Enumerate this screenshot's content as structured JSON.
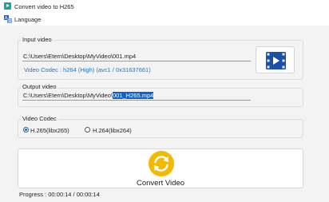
{
  "window": {
    "title": "Convert video to H265"
  },
  "menu": {
    "language_label": "Language"
  },
  "input_video": {
    "label": "Input video",
    "path": "C:\\Users\\Etern\\Desktop\\MyVideo\\001.mp4",
    "codec_info": "Video Codec : h264 (High) (avc1 / 0x31637661)"
  },
  "output_video": {
    "label": "Output video",
    "path_prefix": "C:\\Users\\Etern\\Desktop\\MyVideo\\",
    "path_selected": "001_H265.mp4"
  },
  "video_codec": {
    "label": "Video Codec",
    "options": [
      {
        "label": "H.265(libx265)",
        "selected": true
      },
      {
        "label": "H.264(libx264)",
        "selected": false
      }
    ]
  },
  "convert": {
    "label": "Convert Video"
  },
  "status": {
    "progress_text": "Progress : 00:00:14 / 00:00:14"
  },
  "colors": {
    "accent": "#0f63c9",
    "codec_text": "#1a73c6",
    "convert_icon": "#f5b800",
    "app_icon": "#1aa3a0"
  }
}
